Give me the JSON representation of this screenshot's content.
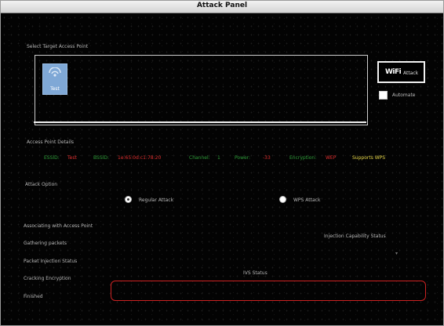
{
  "window": {
    "title": "Attack Panel"
  },
  "target": {
    "section_label": "Select Target Access Point",
    "access_points": [
      {
        "name": "Test"
      }
    ]
  },
  "actions": {
    "attack_label": "Attack",
    "attack_glyph": "WiFi",
    "automate_label": "Automate",
    "automate_checked": false
  },
  "details": {
    "section_label": "Access Point Details",
    "essid_label": "ESSID:",
    "essid_value": "Test",
    "bssid_label": "BSSID:",
    "bssid_value": "1e:65:0d:c1:78:20",
    "channel_label": "Channel:",
    "channel_value": "1",
    "power_label": "Power:",
    "power_value": "-33",
    "encryption_label": "Encryption:",
    "encryption_value": "WEP",
    "wps_label": "Supports WPS"
  },
  "attack_option": {
    "section_label": "Attack Option",
    "regular_label": "Regular Attack",
    "wps_label": "WPS Attack",
    "selected": "regular"
  },
  "steps": [
    "Associating with Access Point",
    "Gathering packets",
    "Packet Injection Status",
    "Cracking Encryption",
    "Finished"
  ],
  "status": {
    "injection_capability_label": "Injection Capability Status",
    "ivs_label": "IVS Status"
  },
  "colors": {
    "label_grey": "#b8b8b8",
    "value_red": "#e03030",
    "label_green": "#2f9e3a",
    "wps_yellow": "#e8d84a",
    "progress_border": "#cc2222"
  }
}
